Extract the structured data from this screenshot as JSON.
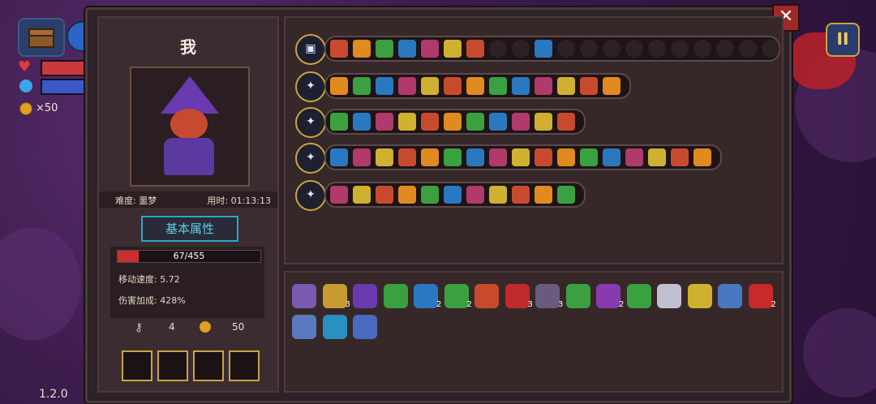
{
  "hud": {
    "coin_count": "×50",
    "version": "1.2.0"
  },
  "buttons": {
    "close_label": "✕",
    "pause_label": "II"
  },
  "character": {
    "name": "我",
    "difficulty": "难度: 噩梦",
    "time_used": "用时: 01:13:13",
    "attr_button": "基本属性",
    "hp": "67/455",
    "hp_fraction": 0.147,
    "move_speed": "移动速度: 5.72",
    "damage_bonus": "伤害加成: 428%",
    "keys": "4",
    "coins": "50"
  },
  "weapons": [
    {
      "name": "chest-weapon-row",
      "slots": 20,
      "color": "#3a8a3a"
    },
    {
      "name": "staff-row-1",
      "slots": 13,
      "color": "#c04a2a"
    },
    {
      "name": "staff-row-2",
      "slots": 11,
      "color": "#c04a2a"
    },
    {
      "name": "staff-row-3",
      "slots": 17,
      "color": "#c04a2a"
    },
    {
      "name": "staff-row-4",
      "slots": 11,
      "color": "#b88a2a"
    }
  ],
  "item_counts": [
    "3",
    "2",
    "2",
    "3",
    "3",
    "2",
    "2"
  ]
}
